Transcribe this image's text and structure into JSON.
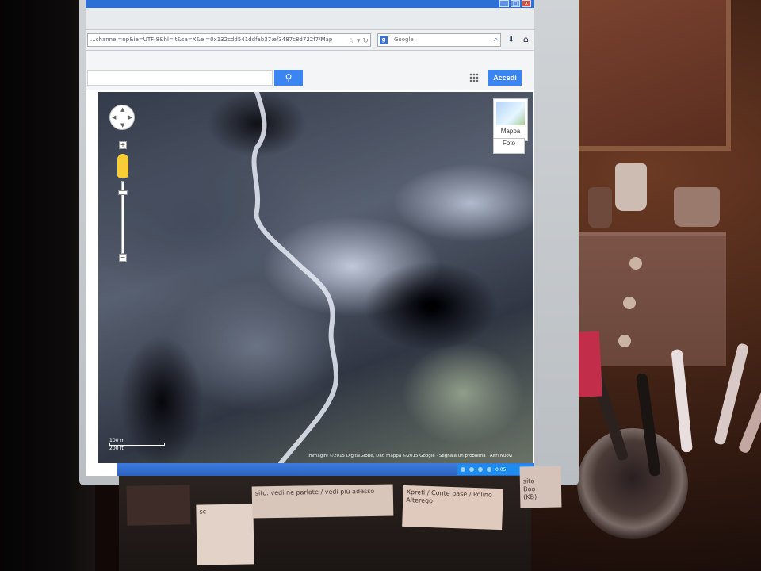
{
  "browser": {
    "url": "...channel=np&ie=UTF-8&hl=it&sa=X&ei=0x132cdd541ddfab37:ef3487c8d722f7/Map",
    "search_engine_badge": "g",
    "search_placeholder": "Google",
    "window_buttons": [
      "_",
      "□",
      "x"
    ]
  },
  "google_header": {
    "search_button_icon": "search-icon",
    "apps_icon": "apps-grid-icon",
    "signin_label": "Accedi"
  },
  "map": {
    "map_type_label": "Mappa",
    "satellite_label": "Foto",
    "zoom_in": "+",
    "zoom_out": "−",
    "scale_metric": "100 m",
    "scale_imperial": "200 ft",
    "attribution": "Immagini ©2015 DigitalGlobe, Dati mappa ©2015 Google  ·  Segnala un problema  ·  Altri Nuovi"
  },
  "taskbar": {
    "clock": "0:05"
  },
  "notes": [
    "",
    "sito: vedi ne parlate / vedi più adesso",
    "sc",
    "Xprefi / Conte base / Polino Alterego",
    "sito\nBoo\n(KB)"
  ],
  "colors": {
    "brand_blue": "#3a85f2",
    "titlebar_blue": "#2e6fd6",
    "taskbar_blue": "#2d63c1"
  }
}
